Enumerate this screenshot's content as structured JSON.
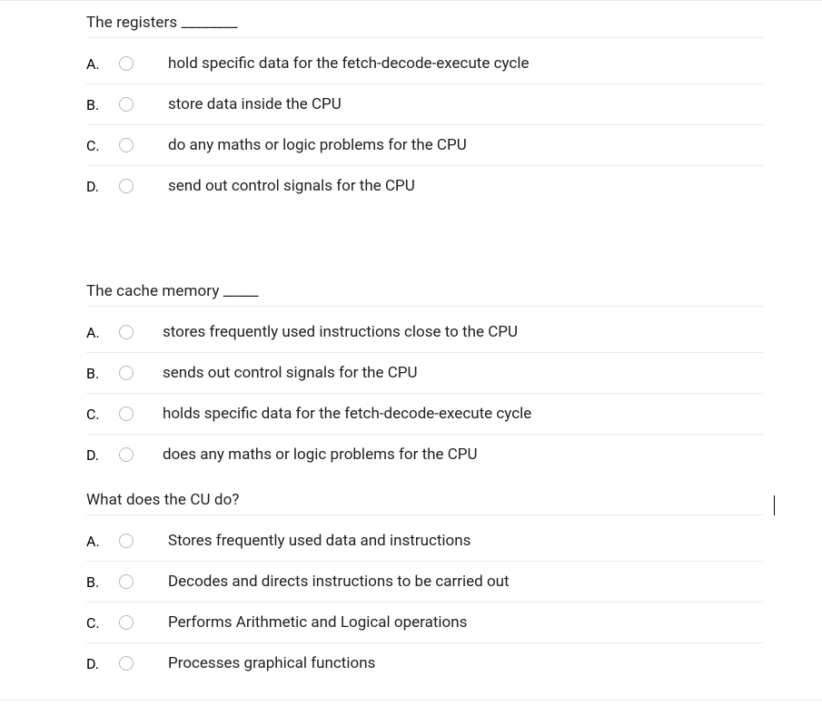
{
  "questions": [
    {
      "prompt": "The registers ________",
      "options": [
        {
          "letter": "A.",
          "text": "hold specific data for the fetch-decode-execute cycle"
        },
        {
          "letter": "B.",
          "text": "store data inside the CPU"
        },
        {
          "letter": "C.",
          "text": "do any maths or logic problems for the CPU"
        },
        {
          "letter": "D.",
          "text": "send out control signals for the CPU"
        }
      ]
    },
    {
      "prompt": "The cache memory _____",
      "options": [
        {
          "letter": "A.",
          "text": "stores frequently used instructions close to the CPU"
        },
        {
          "letter": "B.",
          "text": "sends out control signals for the CPU"
        },
        {
          "letter": "C.",
          "text": "holds specific data for the fetch-decode-execute cycle"
        },
        {
          "letter": "D.",
          "text": "does any maths or logic problems for the CPU"
        }
      ]
    },
    {
      "prompt": "What does the CU do?",
      "options": [
        {
          "letter": "A.",
          "text": "Stores frequently used data and instructions"
        },
        {
          "letter": "B.",
          "text": "Decodes and directs instructions to be carried out"
        },
        {
          "letter": "C.",
          "text": "Performs Arithmetic and Logical operations"
        },
        {
          "letter": "D.",
          "text": "Processes graphical functions"
        }
      ]
    }
  ]
}
